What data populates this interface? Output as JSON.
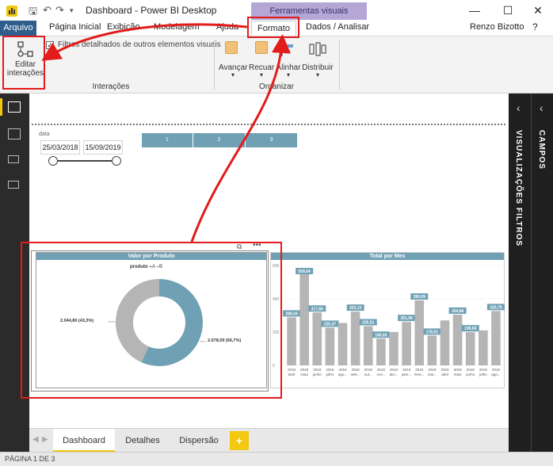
{
  "app": {
    "title": "Dashboard - Power BI Desktop",
    "contextual_tab_group": "Ferramentas visuais",
    "user": "Renzo Bizotto"
  },
  "menu": {
    "items": [
      "Arquivo",
      "Página Inicial",
      "Exibição",
      "Modelagem",
      "Ajuda",
      "Formato",
      "Dados / Analisar"
    ]
  },
  "ribbon": {
    "edit_interactions": "Editar\ninterações",
    "filter_others_checkbox": "Filtros detalhados de outros elementos visuais",
    "group_interactions": "Interações",
    "group_organize": "Organizar",
    "buttons": [
      "Avançar",
      "Recuar",
      "Alinhar",
      "Distribuir"
    ]
  },
  "slicer": {
    "label": "data",
    "start_date": "25/03/2018",
    "end_date": "15/09/2019"
  },
  "page_buttons": [
    "1",
    "2",
    "3"
  ],
  "donut": {
    "title": "Valor por Produto",
    "legend_title": "produto",
    "legend": [
      "A",
      "B"
    ],
    "label_b": "2.044,80 (43,3%)",
    "label_a": "2.678,09 (56,7%)",
    "colors": {
      "A": "#6fa0b4",
      "B": "#b5b5b5"
    }
  },
  "chart_data": {
    "type": "bar",
    "title": "Total por Mes",
    "ylim": [
      0,
      600
    ],
    "yticks": [
      "600",
      "400",
      "200",
      "0"
    ],
    "categories": [
      "2018 abril",
      "2018 maio",
      "2018 junho",
      "2018 julho",
      "2018 ago...",
      "2018 sete...",
      "2018 out...",
      "2018 nov...",
      "2018 dez...",
      "2019 jane...",
      "2019 feve...",
      "2019 mar...",
      "2019 abril",
      "2019 maio",
      "2019 junho",
      "2019 julho",
      "2019 ago..."
    ],
    "values": [
      288.44,
      558.64,
      317.66,
      226.37,
      255,
      323.13,
      235.51,
      160.65,
      200,
      261.06,
      390.09,
      178.91,
      270,
      304.88,
      199.0,
      210,
      326.79
    ],
    "data_labels": [
      "288,44",
      "558,64",
      "317,66",
      "226,37",
      "",
      "323,13",
      "235,51",
      "160,65",
      "",
      "261,06",
      "390,09",
      "178,91",
      "",
      "304,88",
      "199,00",
      "",
      "326,79"
    ],
    "bar_color": "#b5b5b5",
    "label_bg": "#6fa0b4"
  },
  "tabs": [
    "Dashboard",
    "Detalhes",
    "Dispersão",
    "+"
  ],
  "panes": {
    "visualizations": "VISUALIZAÇÕES",
    "filters": "FILTROS",
    "fields": "CAMPOS"
  },
  "status": "PÁGINA 1 DE 3"
}
